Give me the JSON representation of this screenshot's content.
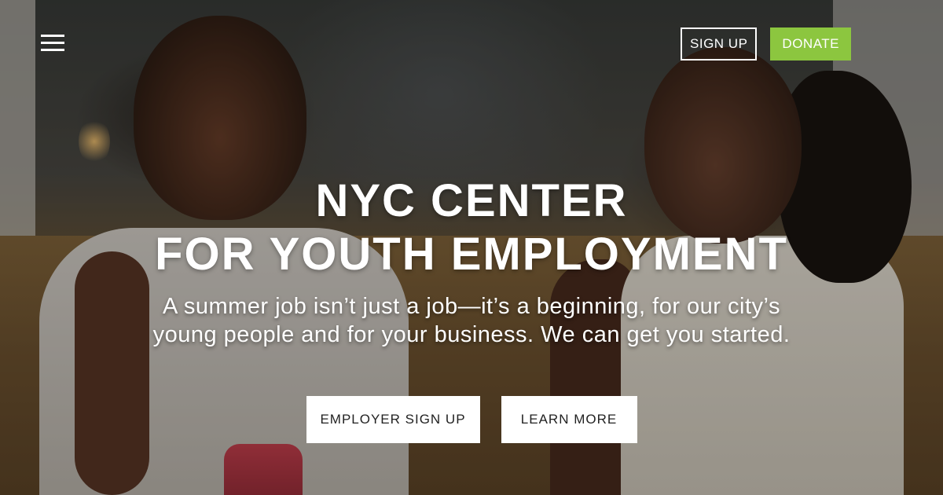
{
  "nav": {
    "menu_icon": "hamburger-menu-icon",
    "sign_up_label": "SIGN UP",
    "donate_label": "DONATE"
  },
  "hero": {
    "title_line1": "NYC CENTER",
    "title_line2": "FOR YOUTH EMPLOYMENT",
    "subtitle_line1": "A summer job isn’t just a job—it’s a beginning, for our city’s",
    "subtitle_line2": "young people and for your business. We can get you started.",
    "cta_employer_label": "EMPLOYER SIGN UP",
    "cta_learn_label": "LEARN MORE"
  },
  "colors": {
    "donate": "#8cc63f",
    "text": "#ffffff",
    "cta_background": "#ffffff",
    "cta_text": "#222222"
  }
}
